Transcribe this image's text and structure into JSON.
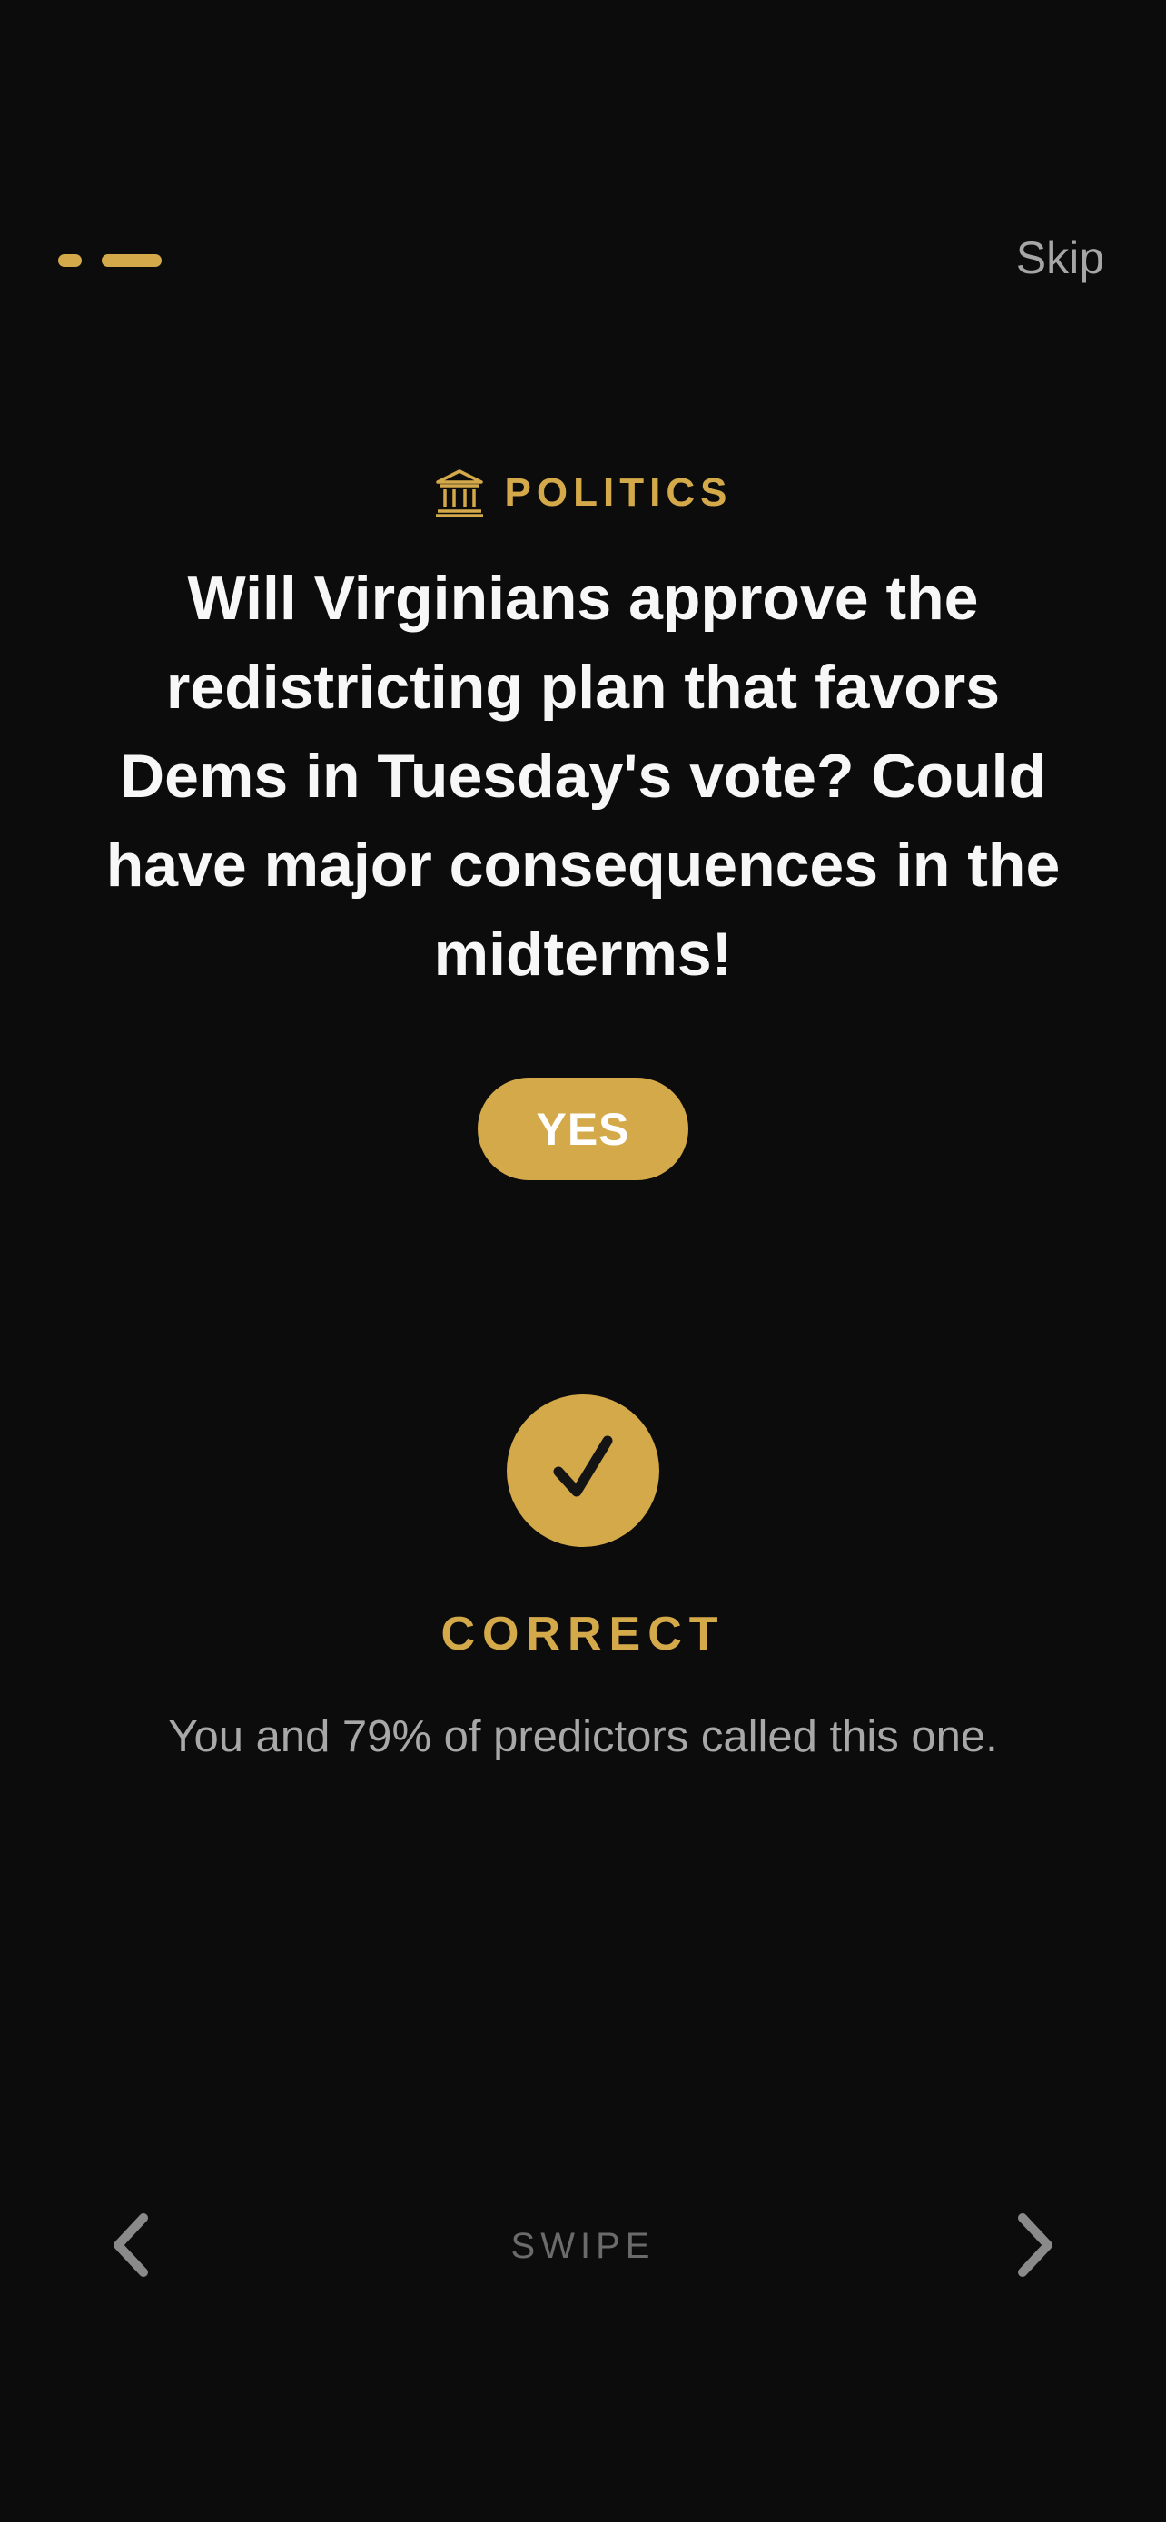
{
  "header": {
    "skip_label": "Skip"
  },
  "progress": {
    "current": 2,
    "total": 2
  },
  "card": {
    "category_icon": "bank-building-icon",
    "category": "POLITICS",
    "question": "Will Virginians approve the redistricting plan that favors Dems in Tuesday's vote? Could have major consequences in the midterms!",
    "answer": "YES"
  },
  "result": {
    "icon": "checkmark-icon",
    "title": "CORRECT",
    "subtitle": "You and 79% of predictors called this one."
  },
  "footer": {
    "swipe_label": "SWIPE",
    "prev_icon": "chevron-left-icon",
    "next_icon": "chevron-right-icon"
  },
  "colors": {
    "background": "#0c0c0c",
    "accent": "#d4a94a",
    "muted_text": "#a8a8a8"
  }
}
